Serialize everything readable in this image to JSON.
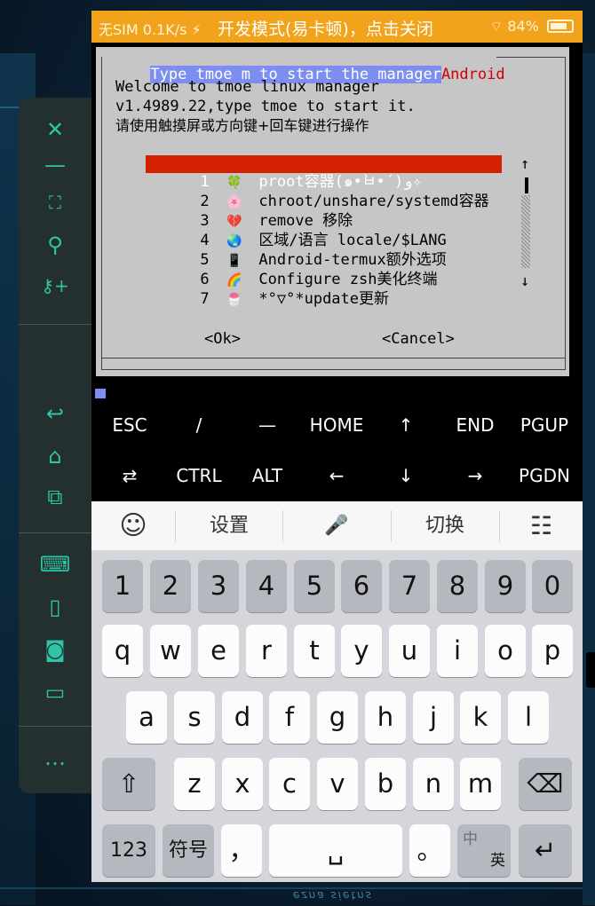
{
  "status_bar": {
    "left": "无SIM 0.1K/s ⚡",
    "center": "开发模式(易卡顿)，点击关闭",
    "right": "84%"
  },
  "terminal": {
    "header_hl": "Type tmoe m to start the manager",
    "header_red": "Android",
    "line1": "Welcome to tmoe linux manager",
    "line2": "v1.4989.22,type tmoe to start it.",
    "line3": "请使用触摸屏或方向键+回车键进行操作",
    "menu": [
      {
        "num": "1",
        "emoji": "🍀",
        "label": "proot容器(๑•̀ㅂ•́)و✧"
      },
      {
        "num": "2",
        "emoji": "🌸",
        "label": "chroot/unshare/systemd容器"
      },
      {
        "num": "3",
        "emoji": "💔",
        "label": "remove 移除"
      },
      {
        "num": "4",
        "emoji": "🌏",
        "label": "区域/语言 locale/$LANG"
      },
      {
        "num": "5",
        "emoji": "📱",
        "label": "Android-termux额外选项"
      },
      {
        "num": "6",
        "emoji": "🌈",
        "label": "Configure zsh美化终端"
      },
      {
        "num": "7",
        "emoji": "🍧",
        "label": "*°▽°*update更新"
      }
    ],
    "scroll_up": "↑",
    "scroll_down": "↓",
    "ok": "<Ok>",
    "cancel": "<Cancel>"
  },
  "extra_keys": {
    "row1": [
      "ESC",
      "/",
      "—",
      "HOME",
      "↑",
      "END",
      "PGUP"
    ],
    "row2": [
      "⇄",
      "CTRL",
      "ALT",
      "←",
      "↓",
      "→",
      "PGDN"
    ]
  },
  "ime_bar": {
    "emoji": "☺",
    "settings": "设置",
    "mic": "🎤",
    "switch": "切换",
    "menu": "☷"
  },
  "keyboard": {
    "numbers": [
      "1",
      "2",
      "3",
      "4",
      "5",
      "6",
      "7",
      "8",
      "9",
      "0"
    ],
    "row1": [
      "q",
      "w",
      "e",
      "r",
      "t",
      "y",
      "u",
      "i",
      "o",
      "p"
    ],
    "row2": [
      "a",
      "s",
      "d",
      "f",
      "g",
      "h",
      "j",
      "k",
      "l"
    ],
    "row3": [
      "z",
      "x",
      "c",
      "v",
      "b",
      "n",
      "m"
    ],
    "shift": "⇧",
    "backspace": "⌫",
    "key_123": "123",
    "symbols": "符号",
    "comma": "，",
    "space": "␣",
    "period": "。",
    "lang_zh": "中",
    "lang_en": "英",
    "enter": "↵"
  },
  "sidebar": {
    "icons": [
      "close-icon",
      "minimize-icon",
      "fullscreen-icon",
      "pin-icon",
      "key-add-icon",
      "back-icon",
      "home-icon",
      "recents-icon",
      "keyboard-icon",
      "phone-icon",
      "camera-icon",
      "folder-icon",
      "more-icon"
    ]
  },
  "background_text": "ezna sietns"
}
